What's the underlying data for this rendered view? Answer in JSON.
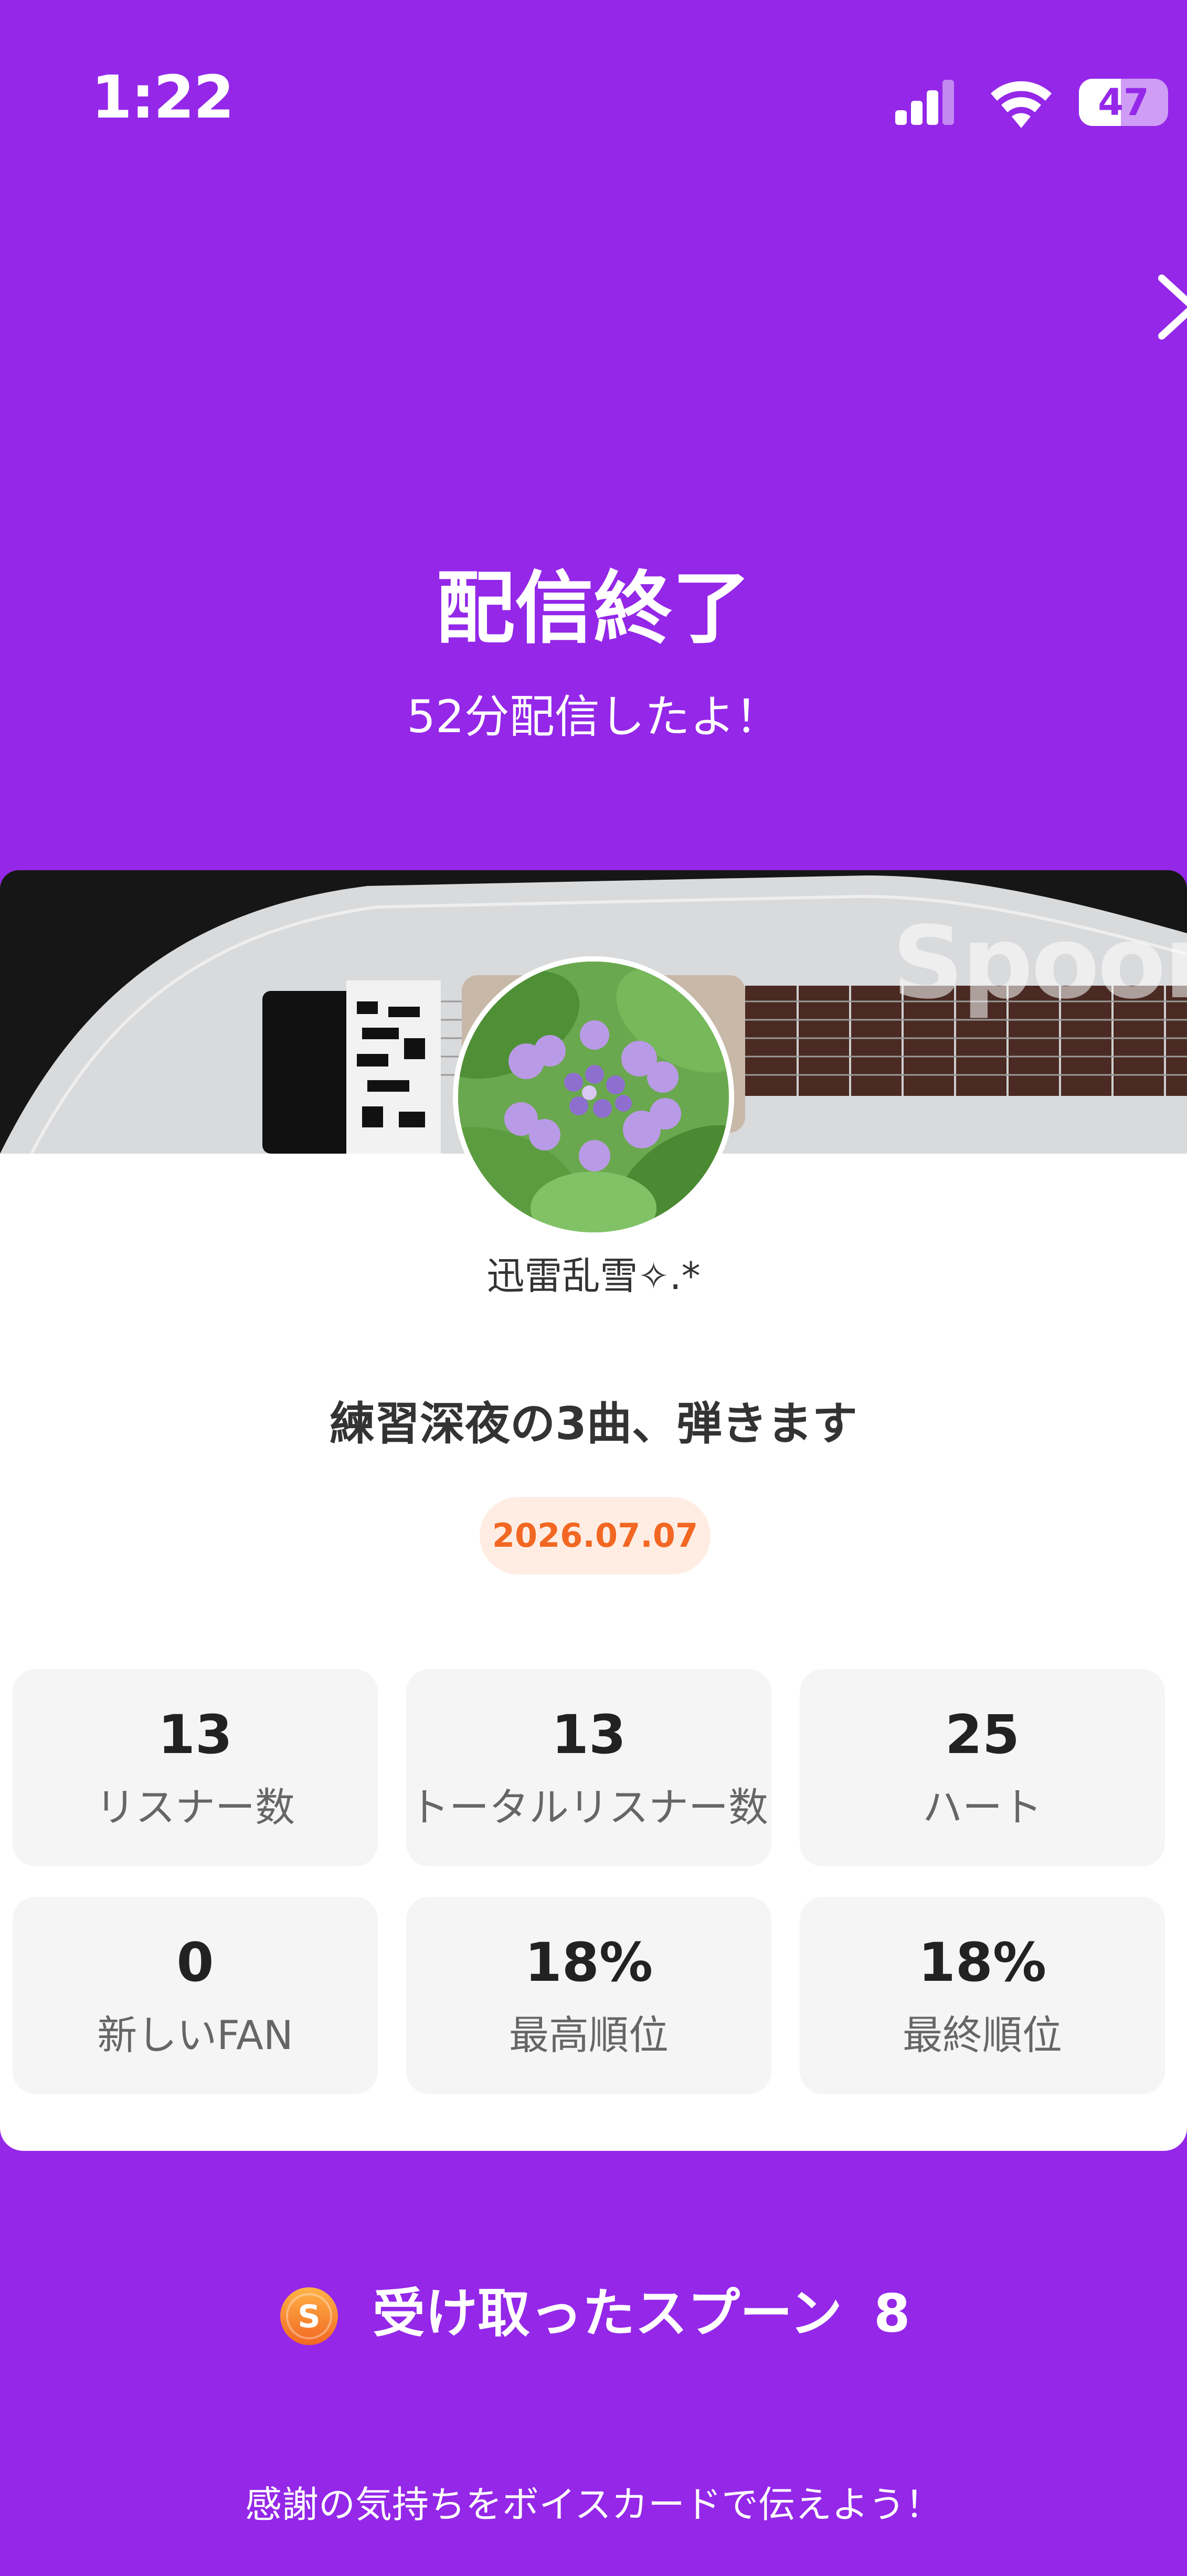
{
  "status_bar": {
    "time": "1:22",
    "battery": "47",
    "icons": [
      "signal-icon",
      "wifi-icon",
      "battery-icon"
    ]
  },
  "header": {
    "title": "配信終了",
    "subtitle": "52分配信したよ！",
    "close_icon": "chevron-right-icon"
  },
  "cover": {
    "watermark": "Spoon"
  },
  "profile": {
    "username": "迅雷乱雪✧.*",
    "stream_title": "練習深夜の3曲、弾きます",
    "date": "2026.07.07"
  },
  "stats": [
    {
      "value": "13",
      "label": "リスナー数"
    },
    {
      "value": "13",
      "label": "トータルリスナー数"
    },
    {
      "value": "25",
      "label": "ハート"
    },
    {
      "value": "0",
      "label": "新しいFAN"
    },
    {
      "value": "18%",
      "label": "最高順位"
    },
    {
      "value": "18%",
      "label": "最終順位"
    }
  ],
  "spoons": {
    "label": "受け取ったスプーン",
    "count": "8",
    "icon": "spoon-coin-icon",
    "coin_letter": "S"
  },
  "footer": {
    "voicecard_text": "感謝の気持ちをボイスカードで伝えよう！"
  },
  "colors": {
    "background": "#9427E8",
    "accent_orange": "#F26722",
    "badge_bg": "#FFEDE4",
    "stat_bg": "#F5F5F5"
  }
}
